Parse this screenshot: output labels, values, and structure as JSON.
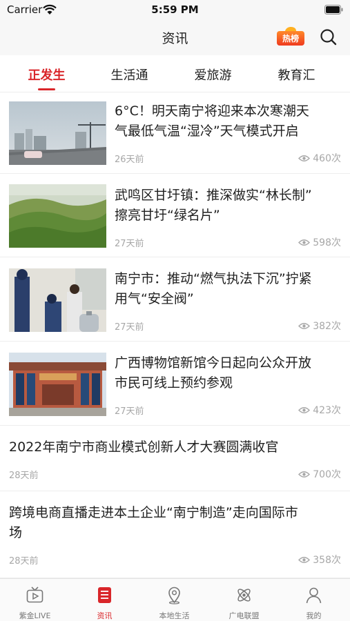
{
  "status_bar": {
    "carrier": "Carrier",
    "time": "5:59 PM"
  },
  "header": {
    "title": "资讯",
    "hot_badge": "热榜",
    "search_icon": "search-icon"
  },
  "tabs": [
    {
      "label": "正发生",
      "active": true
    },
    {
      "label": "生活通",
      "active": false
    },
    {
      "label": "爱旅游",
      "active": false
    },
    {
      "label": "教育汇",
      "active": false
    }
  ],
  "news": [
    {
      "title_line1": "6°C！明天南宁将迎来本次寒潮天",
      "title_line2": "气最低气温“湿冷”天气模式开启",
      "time": "26天前",
      "views": "460次",
      "image": "road-city-photo"
    },
    {
      "title_line1": "武鸣区甘圩镇：推深做实“林长制”",
      "title_line2": "擦亮甘圩“绿名片”",
      "time": "27天前",
      "views": "598次",
      "image": "green-hills-photo"
    },
    {
      "title_line1": "南宁市：推动“燃气执法下沉”拧紧",
      "title_line2": "用气“安全阀”",
      "time": "27天前",
      "views": "382次",
      "image": "gas-inspection-photo"
    },
    {
      "title_line1": "广西博物馆新馆今日起向公众开放",
      "title_line2": "市民可线上预约参观",
      "time": "27天前",
      "views": "423次",
      "image": "museum-building-photo"
    },
    {
      "title_line1": "2022年南宁市商业模式创新人才大赛圆满收官",
      "title_line2": "",
      "time": "28天前",
      "views": "700次"
    },
    {
      "title_line1": "跨境电商直播走进本土企业“南宁制造”走向国际市",
      "title_line2": "场",
      "time": "28天前",
      "views": "358次"
    }
  ],
  "bottom_nav": [
    {
      "label": "紫金LIVE",
      "icon": "tv-play-icon",
      "active": false
    },
    {
      "label": "资讯",
      "icon": "news-list-icon",
      "active": true
    },
    {
      "label": "本地生活",
      "icon": "location-pin-icon",
      "active": false
    },
    {
      "label": "广电联盟",
      "icon": "atom-icon",
      "active": false
    },
    {
      "label": "我的",
      "icon": "person-icon",
      "active": false
    }
  ],
  "colors": {
    "accent": "#d9262a",
    "hot_badge": "#ef3a1f",
    "muted_text": "#a7a7a7"
  }
}
